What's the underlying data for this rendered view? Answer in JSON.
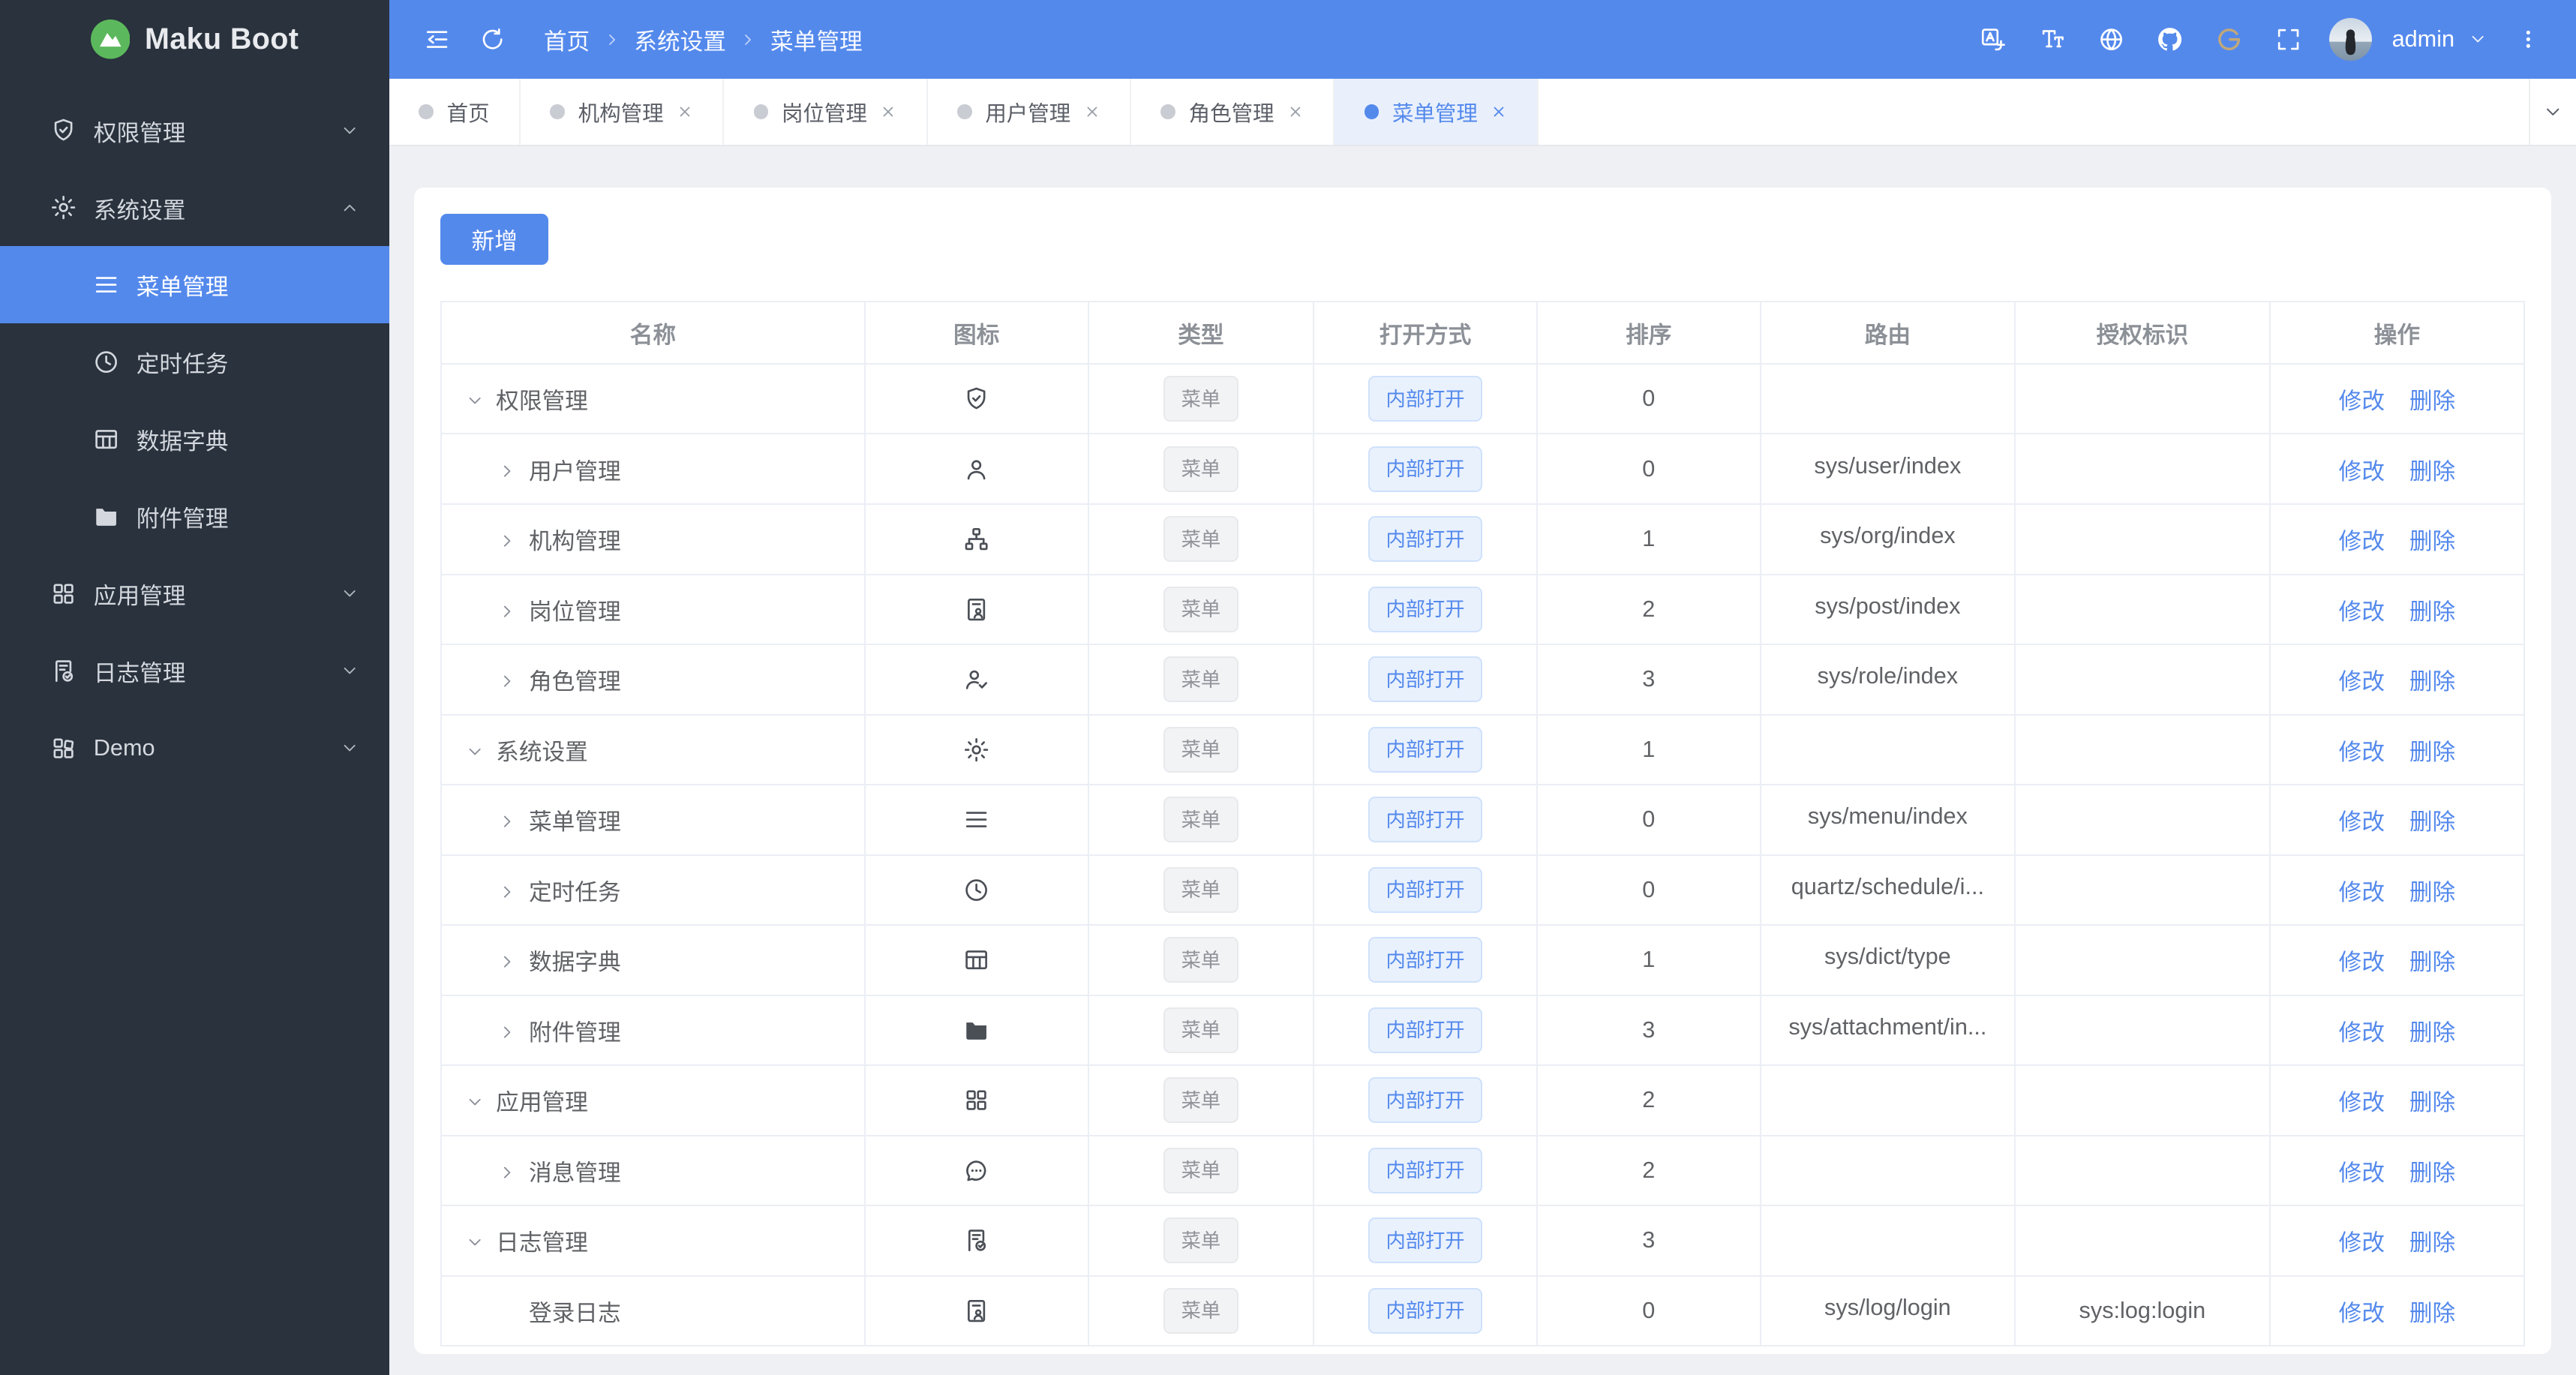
{
  "app": {
    "title": "Maku Boot"
  },
  "colors": {
    "primary": "#5489EC",
    "sidebar_bg": "#29323D",
    "active_item_bg": "#5489EC",
    "content_bg": "#EEF0F4",
    "tag_blue_text": "#5489EC",
    "tag_gray_text": "#909399",
    "gitee_gold": "#C2A878"
  },
  "sidebar": {
    "logo_text": "Maku Boot",
    "logo_icon": "mountain-logo-icon",
    "items": [
      {
        "id": "auth",
        "label": "权限管理",
        "icon": "shield-check-icon",
        "expanded": false
      },
      {
        "id": "system",
        "label": "系统设置",
        "icon": "gear-icon",
        "expanded": true,
        "children": [
          {
            "id": "menu",
            "label": "菜单管理",
            "icon": "menu-lines-icon",
            "active": true
          },
          {
            "id": "schedule",
            "label": "定时任务",
            "icon": "clock-icon",
            "active": false
          },
          {
            "id": "dict",
            "label": "数据字典",
            "icon": "table-grid-icon",
            "active": false
          },
          {
            "id": "attachment",
            "label": "附件管理",
            "icon": "folder-icon",
            "active": false
          }
        ]
      },
      {
        "id": "app",
        "label": "应用管理",
        "icon": "app-grid-icon",
        "expanded": false
      },
      {
        "id": "log",
        "label": "日志管理",
        "icon": "doc-check-icon",
        "expanded": false
      },
      {
        "id": "demo",
        "label": "Demo",
        "icon": "demo-grid-icon",
        "expanded": false
      }
    ]
  },
  "header": {
    "breadcrumb": [
      "首页",
      "系统设置",
      "菜单管理"
    ],
    "left_tools": [
      {
        "name": "collapse-menu-icon"
      },
      {
        "name": "refresh-icon"
      }
    ],
    "right_tools": [
      {
        "name": "translate-icon"
      },
      {
        "name": "font-size-icon"
      },
      {
        "name": "globe-icon"
      },
      {
        "name": "github-icon"
      },
      {
        "name": "gitee-icon"
      },
      {
        "name": "fullscreen-icon"
      }
    ],
    "user": {
      "name": "admin"
    }
  },
  "tabs": {
    "items": [
      {
        "label": "首页",
        "closable": false,
        "active": false
      },
      {
        "label": "机构管理",
        "closable": true,
        "active": false
      },
      {
        "label": "岗位管理",
        "closable": true,
        "active": false
      },
      {
        "label": "用户管理",
        "closable": true,
        "active": false
      },
      {
        "label": "角色管理",
        "closable": true,
        "active": false
      },
      {
        "label": "菜单管理",
        "closable": true,
        "active": true
      }
    ]
  },
  "main": {
    "add_button": "新增",
    "table": {
      "columns": [
        "名称",
        "图标",
        "类型",
        "打开方式",
        "排序",
        "路由",
        "授权标识",
        "操作"
      ],
      "actions": {
        "edit": "修改",
        "delete": "删除"
      },
      "rows": [
        {
          "name": "权限管理",
          "level": 0,
          "expander": "down",
          "icon": "shield-check-icon",
          "type": "菜单",
          "open": "内部打开",
          "sort": "0",
          "route": "",
          "auth": ""
        },
        {
          "name": "用户管理",
          "level": 1,
          "expander": "right",
          "icon": "person-icon",
          "type": "菜单",
          "open": "内部打开",
          "sort": "0",
          "route": "sys/user/index",
          "auth": ""
        },
        {
          "name": "机构管理",
          "level": 1,
          "expander": "right",
          "icon": "sitemap-icon",
          "type": "菜单",
          "open": "内部打开",
          "sort": "1",
          "route": "sys/org/index",
          "auth": ""
        },
        {
          "name": "岗位管理",
          "level": 1,
          "expander": "right",
          "icon": "id-badge-icon",
          "type": "菜单",
          "open": "内部打开",
          "sort": "2",
          "route": "sys/post/index",
          "auth": ""
        },
        {
          "name": "角色管理",
          "level": 1,
          "expander": "right",
          "icon": "person-check-icon",
          "type": "菜单",
          "open": "内部打开",
          "sort": "3",
          "route": "sys/role/index",
          "auth": ""
        },
        {
          "name": "系统设置",
          "level": 0,
          "expander": "down",
          "icon": "gear-icon",
          "type": "菜单",
          "open": "内部打开",
          "sort": "1",
          "route": "",
          "auth": ""
        },
        {
          "name": "菜单管理",
          "level": 1,
          "expander": "right",
          "icon": "menu-lines-icon",
          "type": "菜单",
          "open": "内部打开",
          "sort": "0",
          "route": "sys/menu/index",
          "auth": ""
        },
        {
          "name": "定时任务",
          "level": 1,
          "expander": "right",
          "icon": "clock-icon",
          "type": "菜单",
          "open": "内部打开",
          "sort": "0",
          "route": "quartz/schedule/i...",
          "auth": ""
        },
        {
          "name": "数据字典",
          "level": 1,
          "expander": "right",
          "icon": "table-grid-icon",
          "type": "菜单",
          "open": "内部打开",
          "sort": "1",
          "route": "sys/dict/type",
          "auth": ""
        },
        {
          "name": "附件管理",
          "level": 1,
          "expander": "right",
          "icon": "folder-icon",
          "type": "菜单",
          "open": "内部打开",
          "sort": "3",
          "route": "sys/attachment/in...",
          "auth": ""
        },
        {
          "name": "应用管理",
          "level": 0,
          "expander": "down",
          "icon": "app-grid-icon",
          "type": "菜单",
          "open": "内部打开",
          "sort": "2",
          "route": "",
          "auth": ""
        },
        {
          "name": "消息管理",
          "level": 1,
          "expander": "right",
          "icon": "chat-bubble-icon",
          "type": "菜单",
          "open": "内部打开",
          "sort": "2",
          "route": "",
          "auth": ""
        },
        {
          "name": "日志管理",
          "level": 0,
          "expander": "down",
          "icon": "doc-check-icon",
          "type": "菜单",
          "open": "内部打开",
          "sort": "3",
          "route": "",
          "auth": ""
        },
        {
          "name": "登录日志",
          "level": 1,
          "expander": "none",
          "icon": "id-badge-icon",
          "type": "菜单",
          "open": "内部打开",
          "sort": "0",
          "route": "sys/log/login",
          "auth": "sys:log:login"
        }
      ]
    }
  }
}
